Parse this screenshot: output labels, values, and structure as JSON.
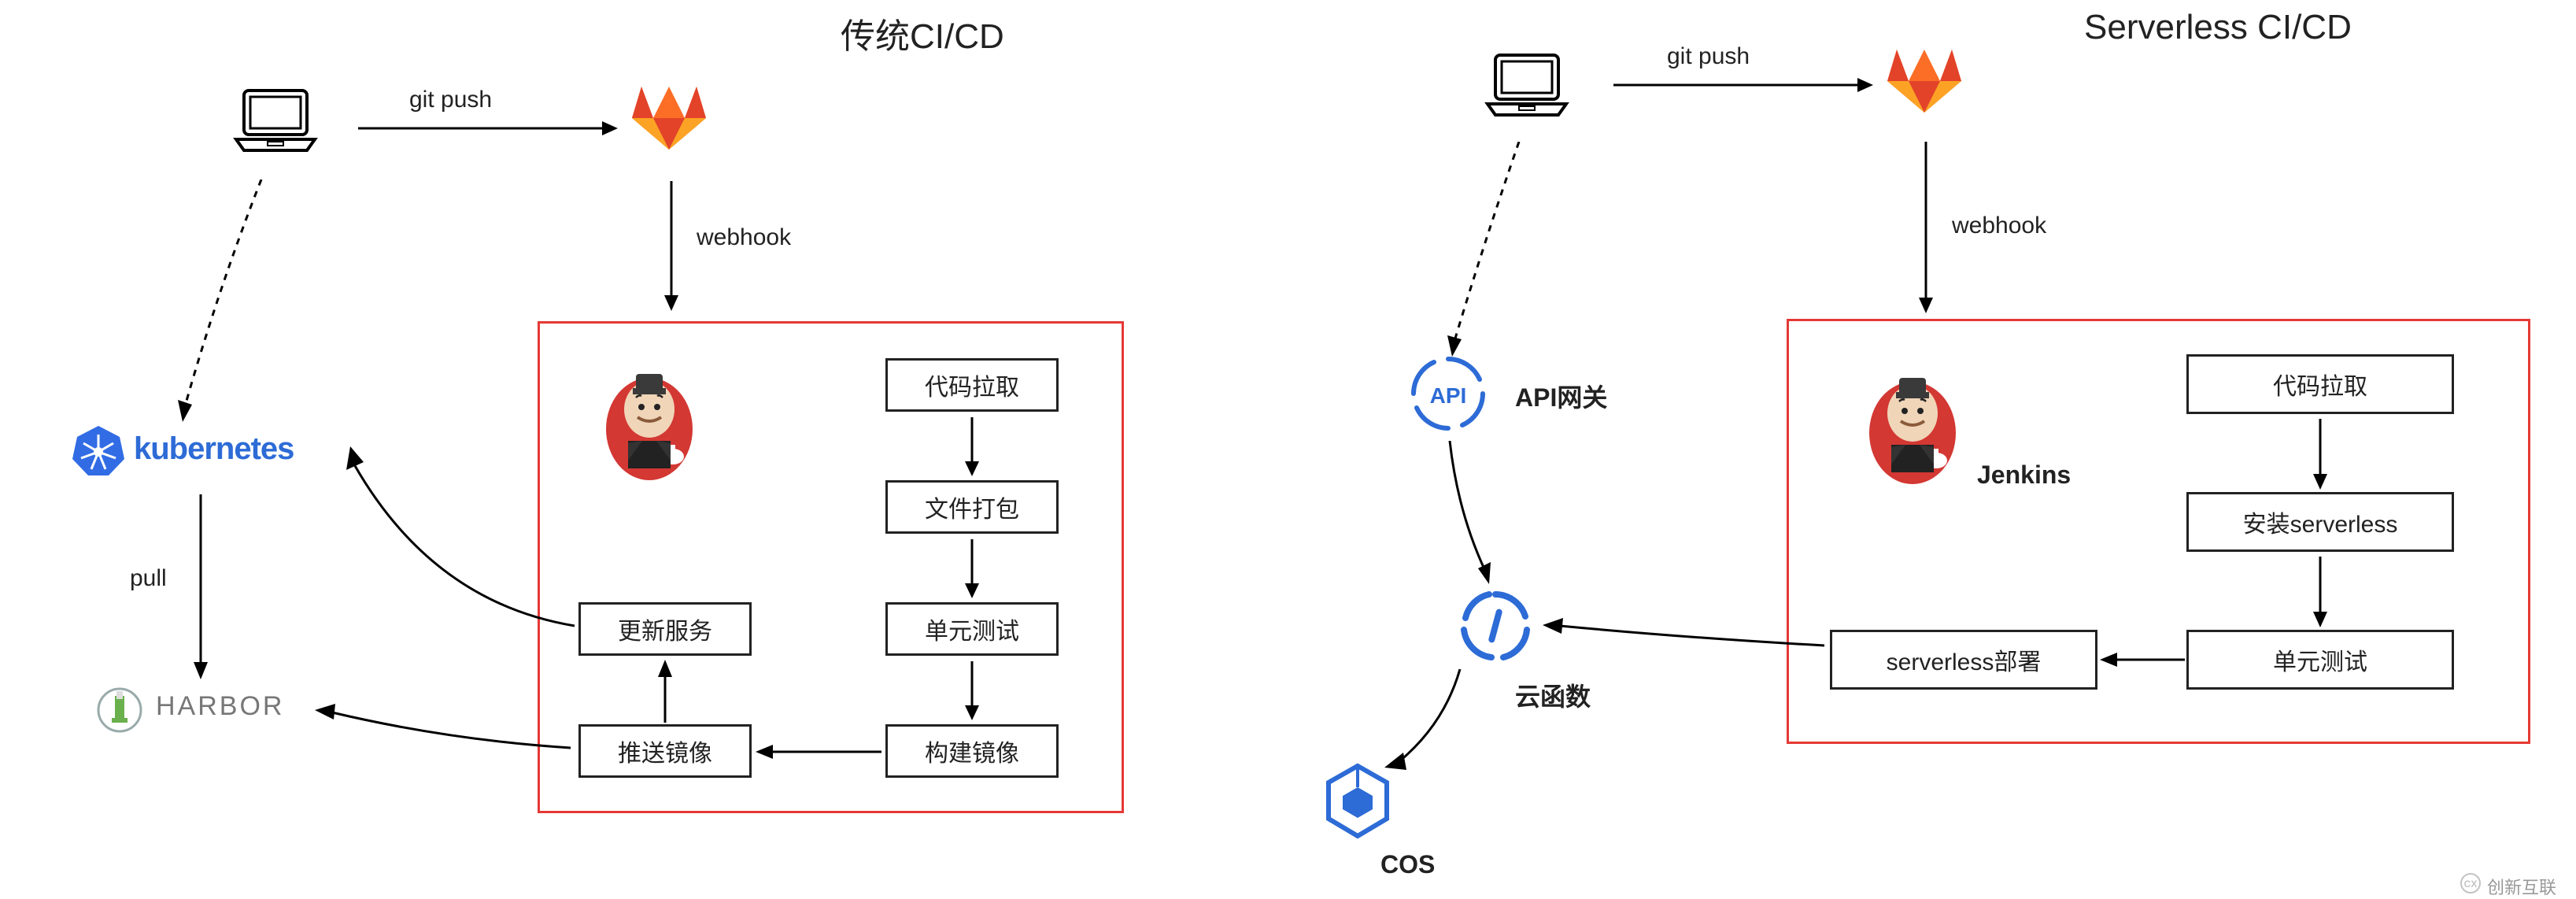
{
  "left": {
    "title": "传统CI/CD",
    "git_push": "git push",
    "webhook": "webhook",
    "kubernetes": "kubernetes",
    "pull": "pull",
    "harbor": "HARBOR",
    "steps": {
      "code_pull": "代码拉取",
      "file_pack": "文件打包",
      "unit_test": "单元测试",
      "build_image": "构建镜像",
      "push_image": "推送镜像",
      "update_service": "更新服务"
    }
  },
  "right": {
    "title": "Serverless CI/CD",
    "git_push": "git push",
    "webhook": "webhook",
    "api_gateway": "API网关",
    "cloud_function": "云函数",
    "cos": "COS",
    "jenkins": "Jenkins",
    "steps": {
      "code_pull": "代码拉取",
      "install_serverless": "安装serverless",
      "unit_test": "单元测试",
      "serverless_deploy": "serverless部署"
    }
  },
  "watermark": "创新互联"
}
